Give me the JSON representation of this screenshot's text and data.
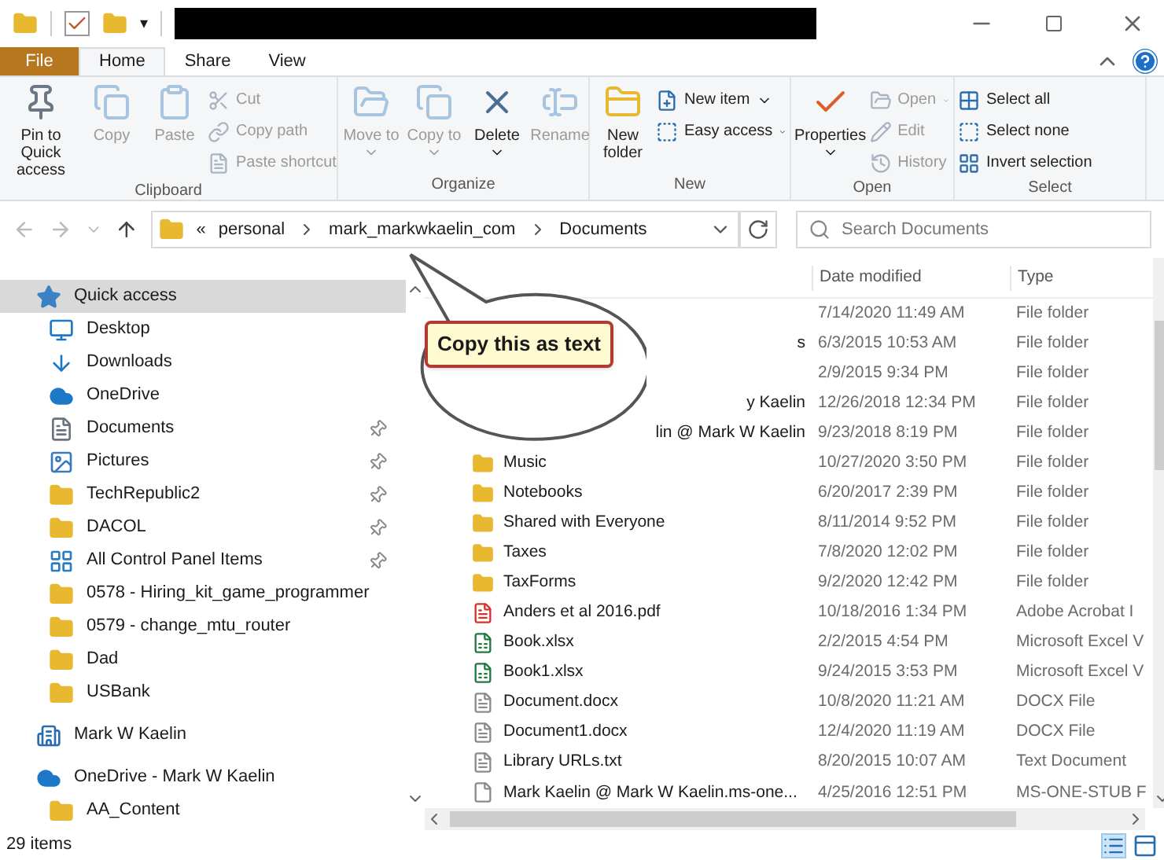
{
  "title_bar": {
    "dropdown_glyph": "▾"
  },
  "ribbon": {
    "tabs": [
      {
        "label": "File",
        "kind": "file",
        "selected": false
      },
      {
        "label": "Home",
        "kind": "tab",
        "selected": true
      },
      {
        "label": "Share",
        "kind": "tab",
        "selected": false
      },
      {
        "label": "View",
        "kind": "tab",
        "selected": false
      }
    ],
    "groups": [
      {
        "label": "Clipboard",
        "large": [
          {
            "label": "Pin to Quick access",
            "kind": "pin",
            "disabled": false,
            "dropdown": false
          },
          {
            "label": "Copy",
            "kind": "copy",
            "disabled": true,
            "dropdown": false
          },
          {
            "label": "Paste",
            "kind": "paste",
            "disabled": true,
            "dropdown": false
          }
        ],
        "small": [
          {
            "label": "Cut",
            "kind": "cut",
            "disabled": true,
            "dropdown": false
          },
          {
            "label": "Copy path",
            "kind": "path",
            "disabled": true,
            "dropdown": false
          },
          {
            "label": "Paste shortcut",
            "kind": "shortcut",
            "disabled": true,
            "dropdown": false
          }
        ]
      },
      {
        "label": "Organize",
        "large": [
          {
            "label": "Move to",
            "kind": "move",
            "disabled": true,
            "dropdown": true
          },
          {
            "label": "Copy to",
            "kind": "copyto",
            "disabled": true,
            "dropdown": true
          },
          {
            "label": "Delete",
            "kind": "delete",
            "disabled": false,
            "dropdown": true
          },
          {
            "label": "Rename",
            "kind": "rename",
            "disabled": true,
            "dropdown": false
          }
        ]
      },
      {
        "label": "New",
        "large": [
          {
            "label": "New folder",
            "kind": "folder",
            "disabled": false,
            "dropdown": false
          }
        ],
        "small": [
          {
            "label": "New item",
            "kind": "newitem",
            "disabled": false,
            "dropdown": true
          },
          {
            "label": "Easy access",
            "kind": "easy",
            "disabled": false,
            "dropdown": true
          }
        ]
      },
      {
        "label": "Open",
        "large": [
          {
            "label": "Properties",
            "kind": "properties",
            "disabled": false,
            "dropdown": true
          }
        ],
        "small": [
          {
            "label": "Open",
            "kind": "open",
            "disabled": true,
            "dropdown": true
          },
          {
            "label": "Edit",
            "kind": "edit",
            "disabled": true,
            "dropdown": false
          },
          {
            "label": "History",
            "kind": "history",
            "disabled": true,
            "dropdown": false
          }
        ]
      },
      {
        "label": "Select",
        "small": [
          {
            "label": "Select all",
            "kind": "selectall",
            "disabled": false,
            "dropdown": false
          },
          {
            "label": "Select none",
            "kind": "selectnone",
            "disabled": false,
            "dropdown": false
          },
          {
            "label": "Invert selection",
            "kind": "invert",
            "disabled": false,
            "dropdown": false
          }
        ]
      }
    ]
  },
  "address_bar": {
    "overflow": "«",
    "path": [
      "personal",
      "mark_markwkaelin_com",
      "Documents"
    ],
    "search_placeholder": "Search Documents"
  },
  "sidebar": {
    "items": [
      {
        "label": "Quick access",
        "kind": "star",
        "selected": true,
        "children": [
          {
            "label": "Desktop",
            "kind": "desktop",
            "pinned": false,
            "selected": false
          },
          {
            "label": "Downloads",
            "kind": "download",
            "pinned": false,
            "selected": false
          },
          {
            "label": "OneDrive",
            "kind": "cloud",
            "pinned": false,
            "selected": false
          },
          {
            "label": "Documents",
            "kind": "document",
            "pinned": true,
            "selected": false
          },
          {
            "label": "Pictures",
            "kind": "picture",
            "pinned": true,
            "selected": false
          },
          {
            "label": "TechRepublic2",
            "kind": "folder",
            "pinned": true,
            "selected": false
          },
          {
            "label": "DACOL",
            "kind": "folder",
            "pinned": true,
            "selected": false
          },
          {
            "label": "All Control Panel Items",
            "kind": "control",
            "pinned": true,
            "selected": false
          },
          {
            "label": "0578 - Hiring_kit_game_programmer",
            "kind": "folder",
            "pinned": false,
            "selected": false
          },
          {
            "label": "0579 - change_mtu_router",
            "kind": "folder",
            "pinned": false,
            "selected": false
          },
          {
            "label": "Dad",
            "kind": "folder",
            "pinned": false,
            "selected": false
          },
          {
            "label": "USBank",
            "kind": "folder",
            "pinned": false,
            "selected": false
          }
        ]
      },
      {
        "label": "Mark W Kaelin",
        "kind": "building",
        "selected": false
      },
      {
        "label": "OneDrive - Mark W Kaelin",
        "kind": "cloud",
        "selected": false,
        "children": [
          {
            "label": "AA_Content",
            "kind": "folder",
            "pinned": false,
            "selected": false
          }
        ]
      }
    ]
  },
  "file_list": {
    "columns": [
      "Date modified",
      "Type"
    ],
    "rows": [
      {
        "kind": "folder",
        "date": "7/14/2020 11:49 AM",
        "type": "File folder"
      },
      {
        "name": "s",
        "covered": true,
        "kind": "folder",
        "date": "6/3/2015 10:53 AM",
        "type": "File folder"
      },
      {
        "kind": "folder",
        "date": "2/9/2015 9:34 PM",
        "type": "File folder"
      },
      {
        "name": "y Kaelin",
        "covered": true,
        "kind": "folder",
        "date": "12/26/2018 12:34 PM",
        "type": "File folder"
      },
      {
        "name": "lin @ Mark W Kaelin",
        "covered": true,
        "kind": "folder",
        "date": "9/23/2018 8:19 PM",
        "type": "File folder"
      },
      {
        "name": "Music",
        "covered": false,
        "kind": "folder",
        "date": "10/27/2020 3:50 PM",
        "type": "File folder"
      },
      {
        "name": "Notebooks",
        "covered": false,
        "kind": "folder",
        "date": "6/20/2017 2:39 PM",
        "type": "File folder"
      },
      {
        "name": "Shared with Everyone",
        "covered": false,
        "kind": "folder",
        "date": "8/11/2014 9:52 PM",
        "type": "File folder"
      },
      {
        "name": "Taxes",
        "covered": false,
        "kind": "folder",
        "date": "7/8/2020 12:02 PM",
        "type": "File folder"
      },
      {
        "name": "TaxForms",
        "covered": false,
        "kind": "folder",
        "date": "9/2/2020 12:42 PM",
        "type": "File folder"
      },
      {
        "name": "Anders et al 2016.pdf",
        "covered": false,
        "kind": "pdf",
        "date": "10/18/2016 1:34 PM",
        "type": "Adobe Acrobat I"
      },
      {
        "name": "Book.xlsx",
        "covered": false,
        "kind": "excel",
        "date": "2/2/2015 4:54 PM",
        "type": "Microsoft Excel V"
      },
      {
        "name": "Book1.xlsx",
        "covered": false,
        "kind": "excel",
        "date": "9/24/2015 3:53 PM",
        "type": "Microsoft Excel V"
      },
      {
        "name": "Document.docx",
        "covered": false,
        "kind": "doc",
        "date": "10/8/2020 11:21 AM",
        "type": "DOCX File"
      },
      {
        "name": "Document1.docx",
        "covered": false,
        "kind": "doc",
        "date": "12/4/2020 11:19 AM",
        "type": "DOCX File"
      },
      {
        "name": "Library URLs.txt",
        "covered": false,
        "kind": "txt",
        "date": "8/20/2015 10:07 AM",
        "type": "Text Document"
      },
      {
        "name": "Mark Kaelin @ Mark W Kaelin.ms-one...",
        "covered": false,
        "kind": "stub",
        "date": "4/25/2016 12:51 PM",
        "type": "MS-ONE-STUB F"
      }
    ]
  },
  "callout": {
    "text": "Copy this as text"
  },
  "status_bar": {
    "item_count": "29 items"
  }
}
